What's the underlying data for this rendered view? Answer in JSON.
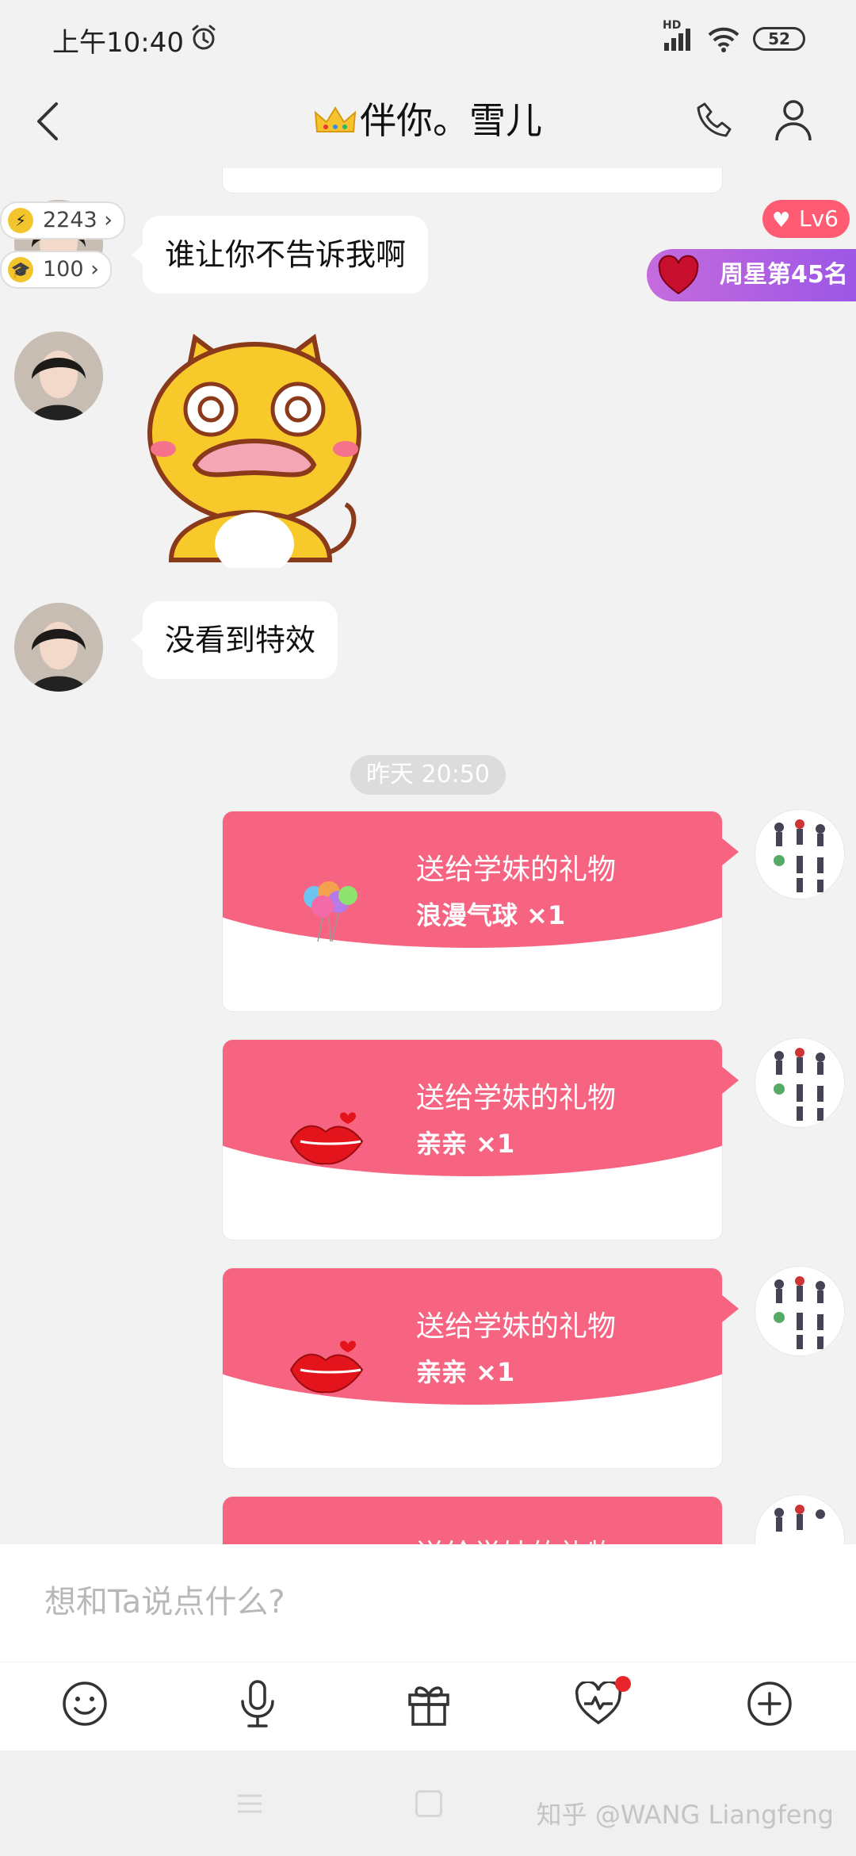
{
  "status_bar": {
    "time": "上午10:40",
    "network": "HD",
    "battery": "52",
    "icons": [
      "alarm-icon",
      "signal-icon",
      "wifi-icon",
      "battery-icon"
    ]
  },
  "header": {
    "title": "伴你。雪儿",
    "back_icon": "chevron-left-icon",
    "call_icon": "phone-icon",
    "profile_icon": "user-icon"
  },
  "badges": {
    "energy": "2243",
    "education": "100",
    "level": "Lv6",
    "weekly_star": "周星第45名"
  },
  "messages": {
    "msg1": "谁让你不告诉我啊",
    "msg2": "没看到特效",
    "timestamp": "昨天 20:50"
  },
  "gifts": [
    {
      "title": "送给学妹的礼物",
      "name": "浪漫气球 ×1",
      "icon": "balloons-icon"
    },
    {
      "title": "送给学妹的礼物",
      "name": "亲亲 ×1",
      "icon": "lips-icon"
    },
    {
      "title": "送给学妹的礼物",
      "name": "亲亲 ×1",
      "icon": "lips-icon"
    },
    {
      "title": "送给学妹的礼物",
      "name": "",
      "icon": ""
    }
  ],
  "composer": {
    "placeholder": "想和Ta说点什么?",
    "actions": [
      "emoji-icon",
      "mic-icon",
      "gift-icon",
      "heart-rate-icon",
      "add-icon"
    ]
  },
  "footer": {
    "watermark": "知乎 @WANG Liangfeng"
  },
  "colors": {
    "gift_pink": "#f66481",
    "level_badge": "#ff5c73",
    "weekly_star": "#b060e0",
    "notification_dot": "#e8242c"
  }
}
